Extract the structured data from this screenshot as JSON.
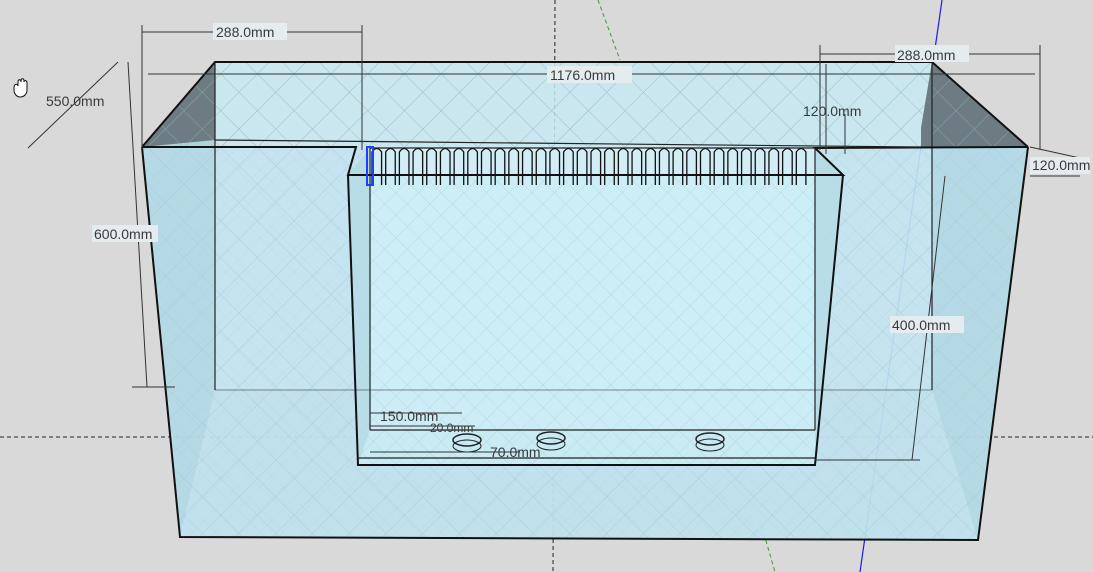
{
  "app": "SketchUp model view",
  "tool": {
    "icon": "pan-hand-icon"
  },
  "colors": {
    "background": "#d9d9d9",
    "glass": "#bfe3ef",
    "glass_dark": "#7d8c93",
    "edge": "#111111",
    "axis_blue": "#1a1aff",
    "axis_green": "#3a9a3a",
    "selection": "#1f3fff"
  },
  "dimensions": {
    "top_left_width": "288.0mm",
    "top_right_width": "288.0mm",
    "overall_length": "1176.0mm",
    "depth": "550.0mm",
    "height": "600.0mm",
    "comb_height": "120.0mm",
    "right_offset": "120.0mm",
    "sump_height": "400.0mm",
    "hole_spacing": "150.0mm",
    "hole_offset": "20.0mm",
    "bottom_offset": "70.0mm"
  },
  "overflow_box": {
    "teeth_count": 32,
    "bulkhead_holes": 3
  }
}
